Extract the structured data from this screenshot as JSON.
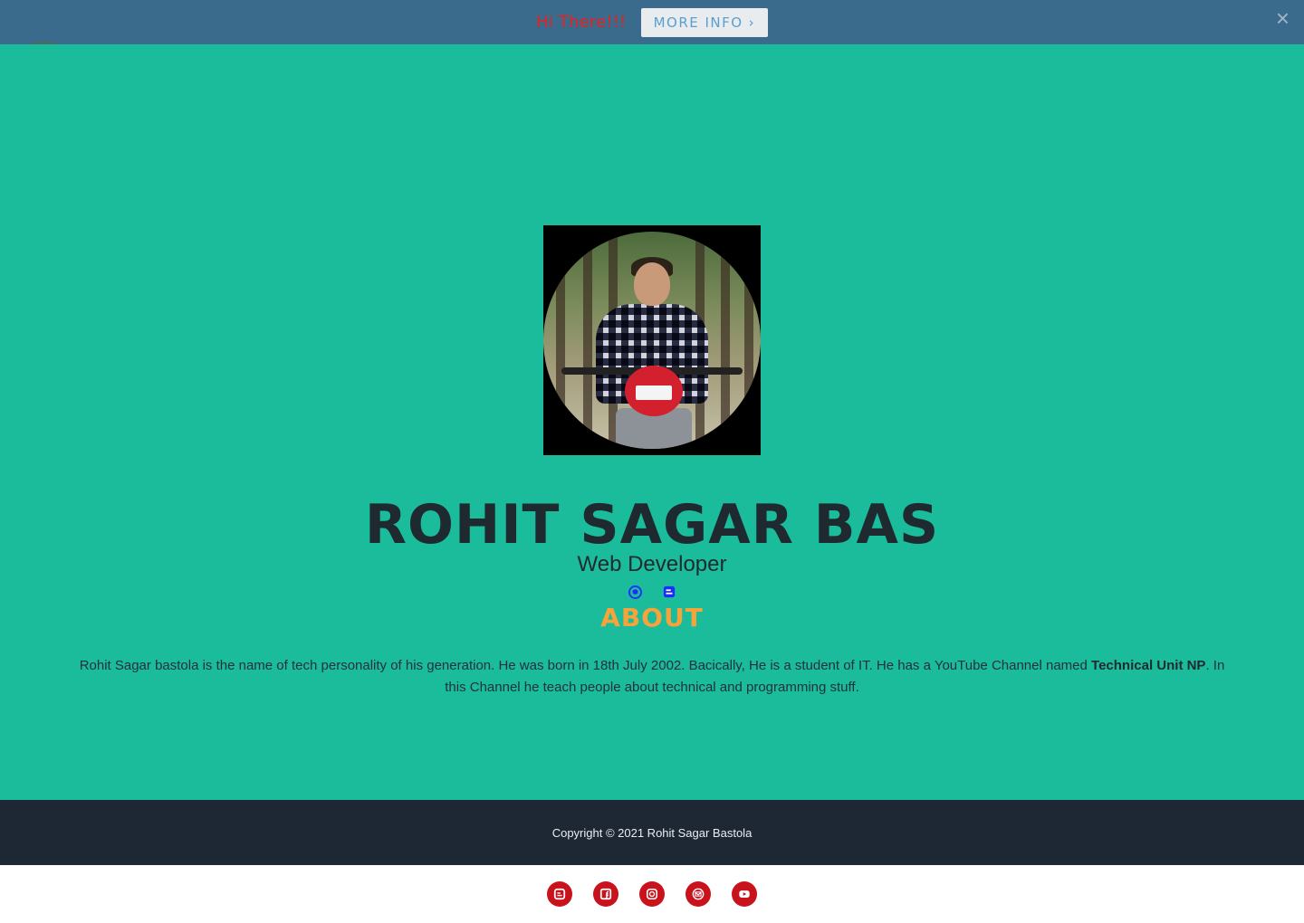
{
  "topbar": {
    "greeting": "Hi There!!!",
    "more_info_label": "MORE INFO",
    "more_info_icon": "chevron-right-icon",
    "close_icon": "close-icon"
  },
  "nav": {
    "menu_icon": "hamburger-menu-icon"
  },
  "hero": {
    "name": "ROHIT SAGAR BAS",
    "role": "Web Developer",
    "links": [
      {
        "icon": "github-icon"
      },
      {
        "icon": "blogger-icon"
      }
    ]
  },
  "about": {
    "heading": "ABOUT",
    "text_part1": "Rohit Sagar bastola is the name of tech personality of his generation. He was born in 18th July 2002. Bacically, He is a student of IT. He has a YouTube Channel named ",
    "channel_name": "Technical Unit NP",
    "text_part2": ". In this Channel he teach people about technical and programming stuff."
  },
  "footer": {
    "copyright": "Copyright © 2021 Rohit Sagar Bastola"
  },
  "social_bar": [
    {
      "icon": "blogger-icon"
    },
    {
      "icon": "facebook-icon"
    },
    {
      "icon": "instagram-icon"
    },
    {
      "icon": "email-icon"
    },
    {
      "icon": "youtube-icon"
    }
  ],
  "colors": {
    "page_background": "#1abc9c",
    "topbar": "#3a6b8c",
    "greeting": "#e8211f",
    "about_heading": "#f5a33a",
    "footer": "#1e2734",
    "social_icon": "#c8121c"
  }
}
